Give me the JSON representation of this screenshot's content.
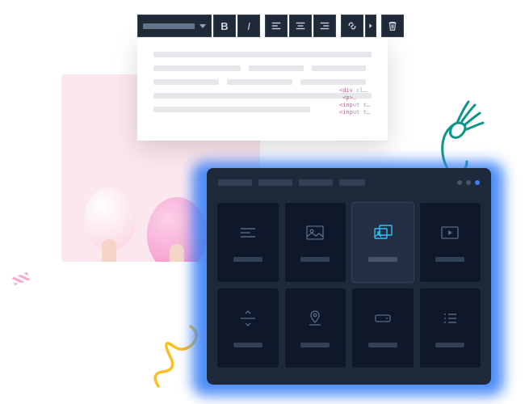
{
  "toolbar": {
    "bold_label": "B",
    "italic_label": "I"
  },
  "panel": {
    "tiles": [
      {
        "name": "text"
      },
      {
        "name": "image"
      },
      {
        "name": "gallery"
      },
      {
        "name": "video"
      },
      {
        "name": "spacer"
      },
      {
        "name": "map"
      },
      {
        "name": "button"
      },
      {
        "name": "list"
      }
    ],
    "active_index": 2
  },
  "colors": {
    "accent": "#3b82f6",
    "panel_bg": "#1e293b",
    "tile_active": "#38bdf8"
  }
}
